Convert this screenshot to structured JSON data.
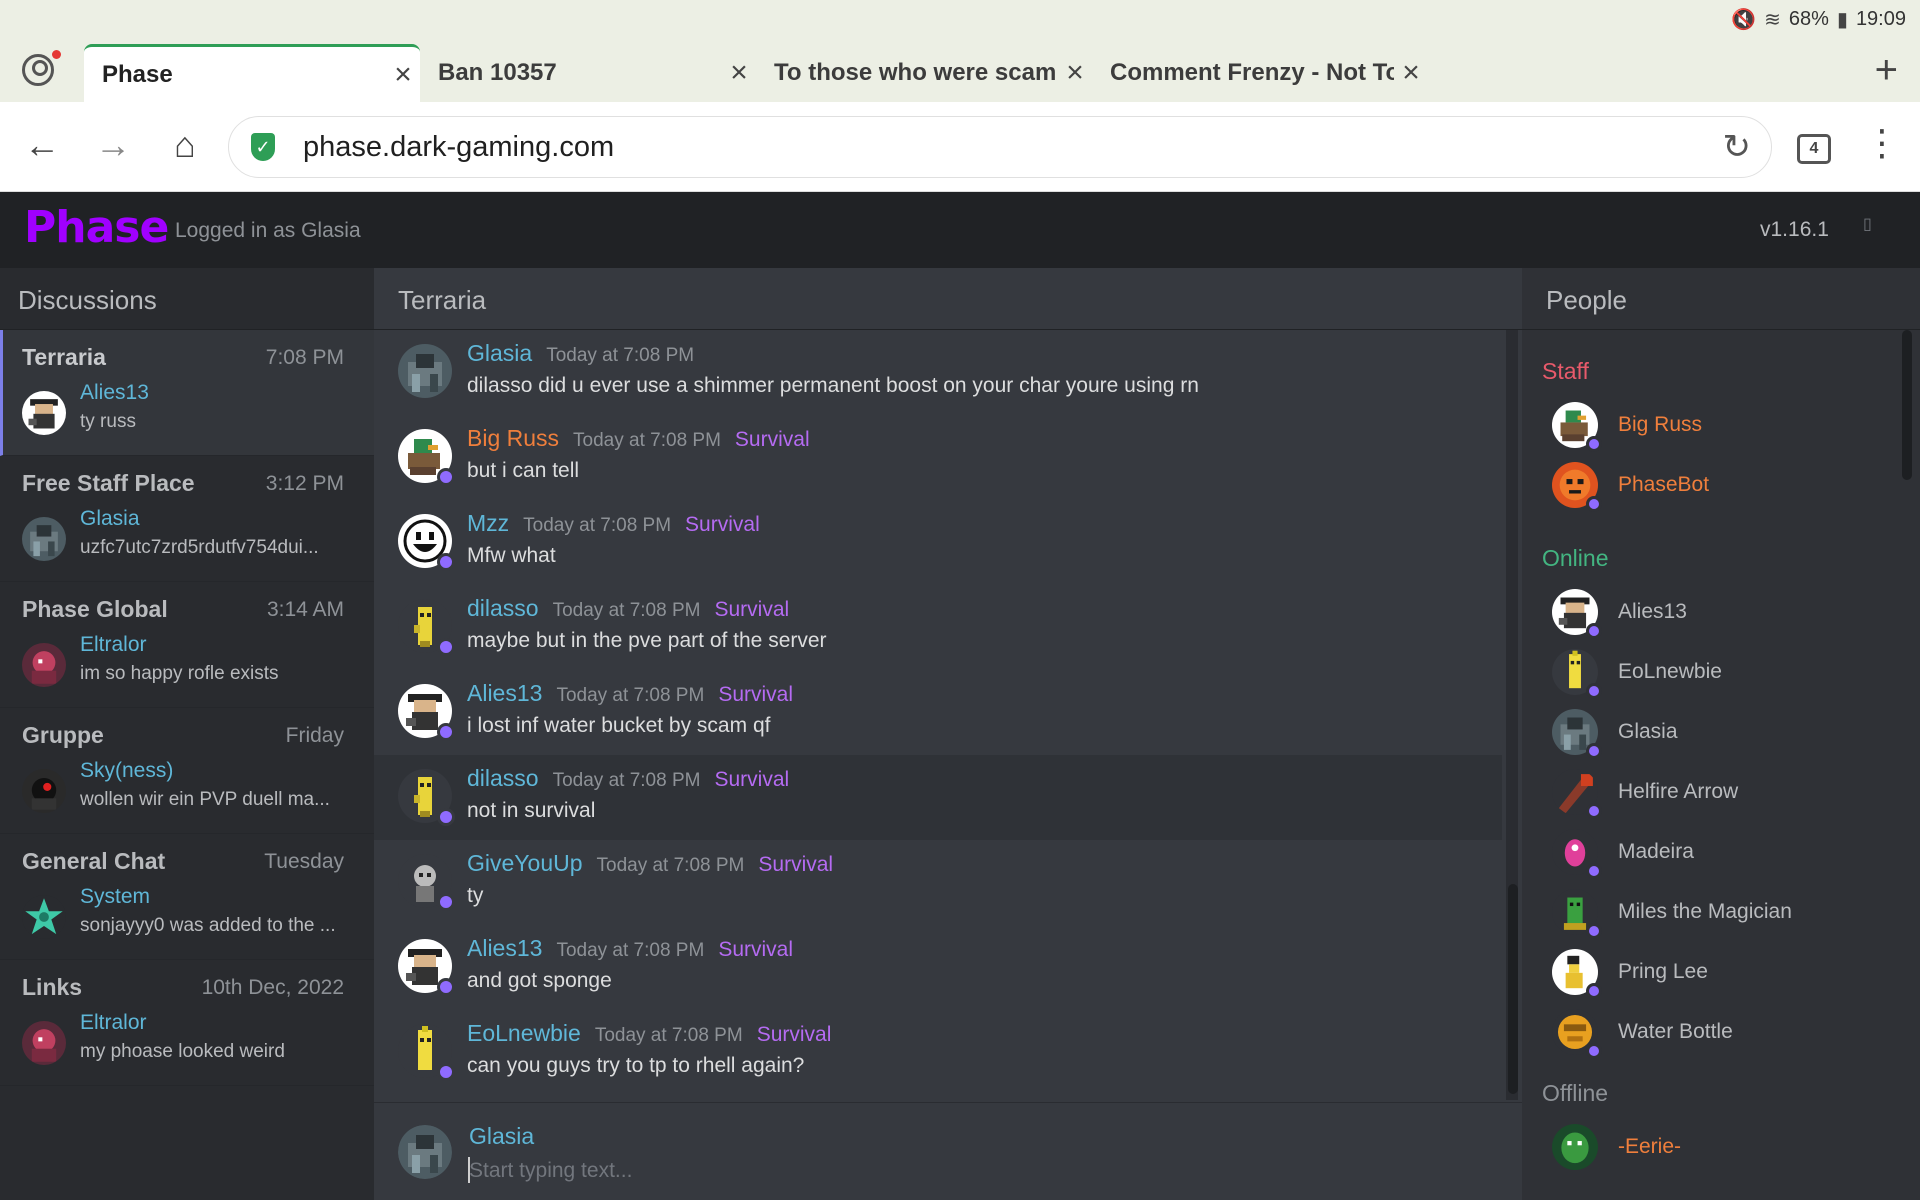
{
  "status_bar": {
    "battery": "68%",
    "time": "19:09"
  },
  "browser": {
    "tabs": [
      {
        "title": "Phase"
      },
      {
        "title": "Ban 10357"
      },
      {
        "title": "To those who were scam"
      },
      {
        "title": "Comment Frenzy - Not To"
      }
    ],
    "url": "phase.dark-gaming.com",
    "tab_count": "4"
  },
  "app": {
    "logo": "Phase",
    "logged_in": "Logged in as Glasia",
    "version": "v1.16.1"
  },
  "discussions": {
    "heading": "Discussions",
    "items": [
      {
        "name": "Terraria",
        "time": "7:08 PM",
        "user": "Alies13",
        "msg": "ty russ"
      },
      {
        "name": "Free Staff Place",
        "time": "3:12 PM",
        "user": "Glasia",
        "msg": "uzfc7utc7zrd5rdutfv754dui..."
      },
      {
        "name": "Phase Global",
        "time": "3:14 AM",
        "user": "Eltralor",
        "msg": "im so happy rofle exists"
      },
      {
        "name": "Gruppe",
        "time": "Friday",
        "user": "Sky(ness)",
        "msg": "wollen wir ein PVP duell ma..."
      },
      {
        "name": "General Chat",
        "time": "Tuesday",
        "user": "System",
        "msg": "sonjayyy0 was added to the ..."
      },
      {
        "name": "Links",
        "time": "10th Dec, 2022",
        "user": "Eltralor",
        "msg": "my phoase looked weird"
      }
    ]
  },
  "chat": {
    "heading": "Terraria",
    "messages": [
      {
        "user": "Glasia",
        "time": "Today at 7:08 PM",
        "role": "",
        "text": "dilasso did u ever use a shimmer permanent boost on your char youre using rn"
      },
      {
        "user": "Big Russ",
        "time": "Today at 7:08 PM",
        "role": "Survival",
        "text": "but i can tell"
      },
      {
        "user": "Mzz",
        "time": "Today at 7:08 PM",
        "role": "Survival",
        "text": "Mfw what"
      },
      {
        "user": "dilasso",
        "time": "Today at 7:08 PM",
        "role": "Survival",
        "text": "maybe but in the pve part of the server"
      },
      {
        "user": "Alies13",
        "time": "Today at 7:08 PM",
        "role": "Survival",
        "text": "i lost inf water bucket by scam qf"
      },
      {
        "user": "dilasso",
        "time": "Today at 7:08 PM",
        "role": "Survival",
        "text": "not in survival"
      },
      {
        "user": "GiveYouUp",
        "time": "Today at 7:08 PM",
        "role": "Survival",
        "text": "ty"
      },
      {
        "user": "Alies13",
        "time": "Today at 7:08 PM",
        "role": "Survival",
        "text": "and got sponge"
      },
      {
        "user": "EoLnewbie",
        "time": "Today at 7:08 PM",
        "role": "Survival",
        "text": "can you guys try to tp to rhell again?"
      }
    ],
    "composer": {
      "user": "Glasia",
      "placeholder": "Start typing text..."
    }
  },
  "people": {
    "heading": "People",
    "staff_label": "Staff",
    "online_label": "Online",
    "offline_label": "Offline",
    "staff": [
      "Big Russ",
      "PhaseBot"
    ],
    "online": [
      "Alies13",
      "EoLnewbie",
      "Glasia",
      "Helfire Arrow",
      "Madeira",
      "Miles the Magician",
      "Pring Lee",
      "Water Bottle"
    ],
    "offline": [
      "-Eerie-"
    ]
  },
  "colors": {
    "accent_logo": "#a000ff",
    "username": "#5fb7d8",
    "staff_name": "#f07f3c",
    "role": "#b56bf2",
    "presence_dot": "#8f6bff"
  }
}
